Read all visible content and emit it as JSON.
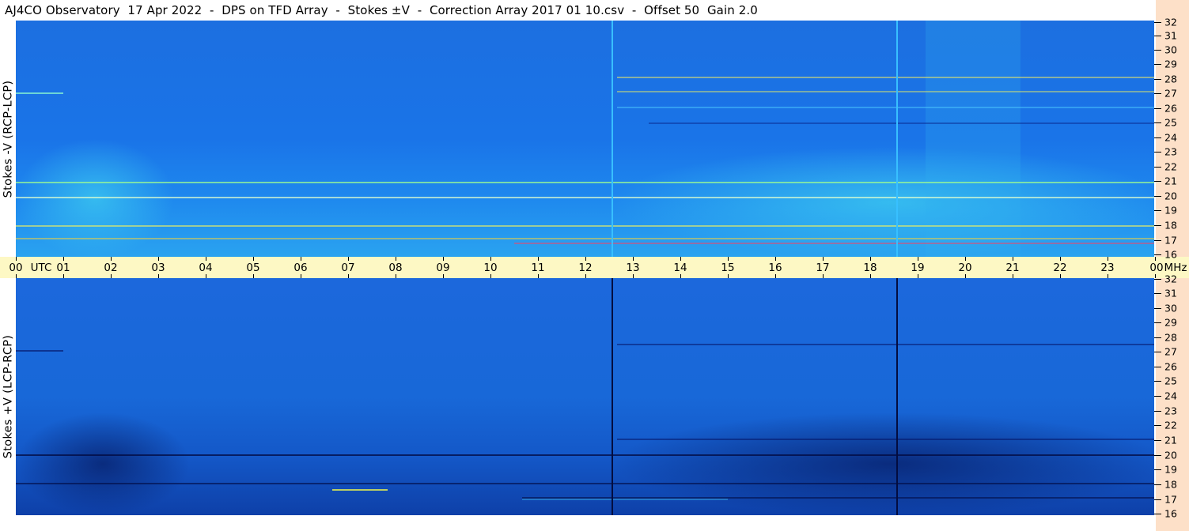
{
  "title": "AJ4CO Observatory  17 Apr 2022  -  DPS on TFD Array  -  Stokes ±V  -  Correction Array 2017 01 10.csv  -  Offset 50  Gain 2.0",
  "top_panel": {
    "label": "Stokes -V (RCP-LCP)"
  },
  "bottom_panel": {
    "label": "Stokes +V (LCP-RCP)"
  },
  "time_axis": {
    "labels": [
      "00",
      "01",
      "02",
      "03",
      "04",
      "05",
      "06",
      "07",
      "08",
      "09",
      "10",
      "11",
      "12",
      "13",
      "14",
      "15",
      "16",
      "17",
      "18",
      "19",
      "20",
      "21",
      "22",
      "23",
      "00"
    ],
    "unit_utc": "UTC",
    "unit_mhz": "MHz"
  },
  "freq_axis": {
    "labels": [
      "32",
      "31",
      "30",
      "29",
      "28",
      "27",
      "26",
      "25",
      "24",
      "23",
      "22",
      "21",
      "20",
      "19",
      "18",
      "17",
      "16"
    ]
  },
  "colors": {
    "panel_background": "#1a78e6",
    "axis_background": "#fdf8c4",
    "right_strip": "#fde0c8"
  }
}
